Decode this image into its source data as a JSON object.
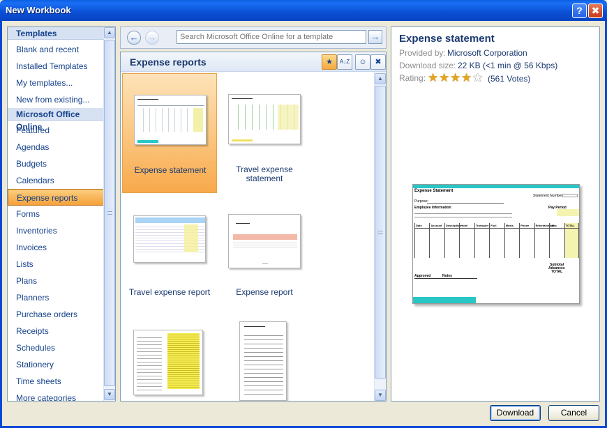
{
  "window": {
    "title": "New Workbook",
    "help_icon": "?",
    "close_icon": "✖"
  },
  "sidebar": {
    "items": [
      {
        "label": "Templates",
        "type": "header"
      },
      {
        "label": "Blank and recent"
      },
      {
        "label": "Installed Templates"
      },
      {
        "label": "My templates..."
      },
      {
        "label": "New from existing..."
      },
      {
        "label": "Microsoft Office Online",
        "type": "header"
      },
      {
        "label": "Featured"
      },
      {
        "label": "Agendas"
      },
      {
        "label": "Budgets"
      },
      {
        "label": "Calendars"
      },
      {
        "label": "Expense reports",
        "selected": true
      },
      {
        "label": "Forms"
      },
      {
        "label": "Inventories"
      },
      {
        "label": "Invoices"
      },
      {
        "label": "Lists"
      },
      {
        "label": "Plans"
      },
      {
        "label": "Planners"
      },
      {
        "label": "Purchase orders"
      },
      {
        "label": "Receipts"
      },
      {
        "label": "Schedules"
      },
      {
        "label": "Stationery"
      },
      {
        "label": "Time sheets"
      },
      {
        "label": "More categories"
      }
    ]
  },
  "search": {
    "placeholder": "Search Microsoft Office Online for a template",
    "back_icon": "←",
    "forward_icon": "→",
    "go_icon": "→"
  },
  "gallery": {
    "heading": "Expense reports",
    "sort_icons": [
      "sort-by-rating-icon",
      "sort-az-icon",
      "view-icon",
      "user-icon"
    ],
    "sort_glyphs": [
      "★",
      "A↓Z",
      "☺",
      "✖"
    ],
    "templates": [
      {
        "label": "Expense statement",
        "selected": true
      },
      {
        "label": "Travel expense\nstatement"
      },
      {
        "label": "Travel expense report"
      },
      {
        "label": "Expense report"
      },
      {
        "label": ""
      },
      {
        "label": ""
      }
    ]
  },
  "details": {
    "title": "Expense statement",
    "provided_by_label": "Provided by:",
    "provided_by": "Microsoft Corporation",
    "download_size_label": "Download size:",
    "download_size": "22 KB (<1 min @ 56 Kbps)",
    "rating_label": "Rating:",
    "rating": 4,
    "rating_max": 5,
    "votes": "(561 Votes)",
    "preview": {
      "title": "Expense Statement",
      "statement_number": "Statement Number:",
      "purpose": "Purpose:",
      "employee_info": "Employee Information",
      "pay_period": "Pay Period",
      "columns": [
        "Date",
        "Account",
        "Description",
        "Hotel",
        "Transport",
        "Fuel",
        "Meals",
        "Phone",
        "Entertainment",
        "Misc.",
        "TOTAL"
      ],
      "subtotal": "Subtotal",
      "advances": "Advances",
      "total": "TOTAL",
      "approved": "Approved",
      "notes": "Notes"
    }
  },
  "buttons": {
    "download": "Download",
    "cancel": "Cancel"
  },
  "colors": {
    "accent": "#0a4fd4",
    "selected": "#f8a94a",
    "link_text": "#1c3a70"
  }
}
